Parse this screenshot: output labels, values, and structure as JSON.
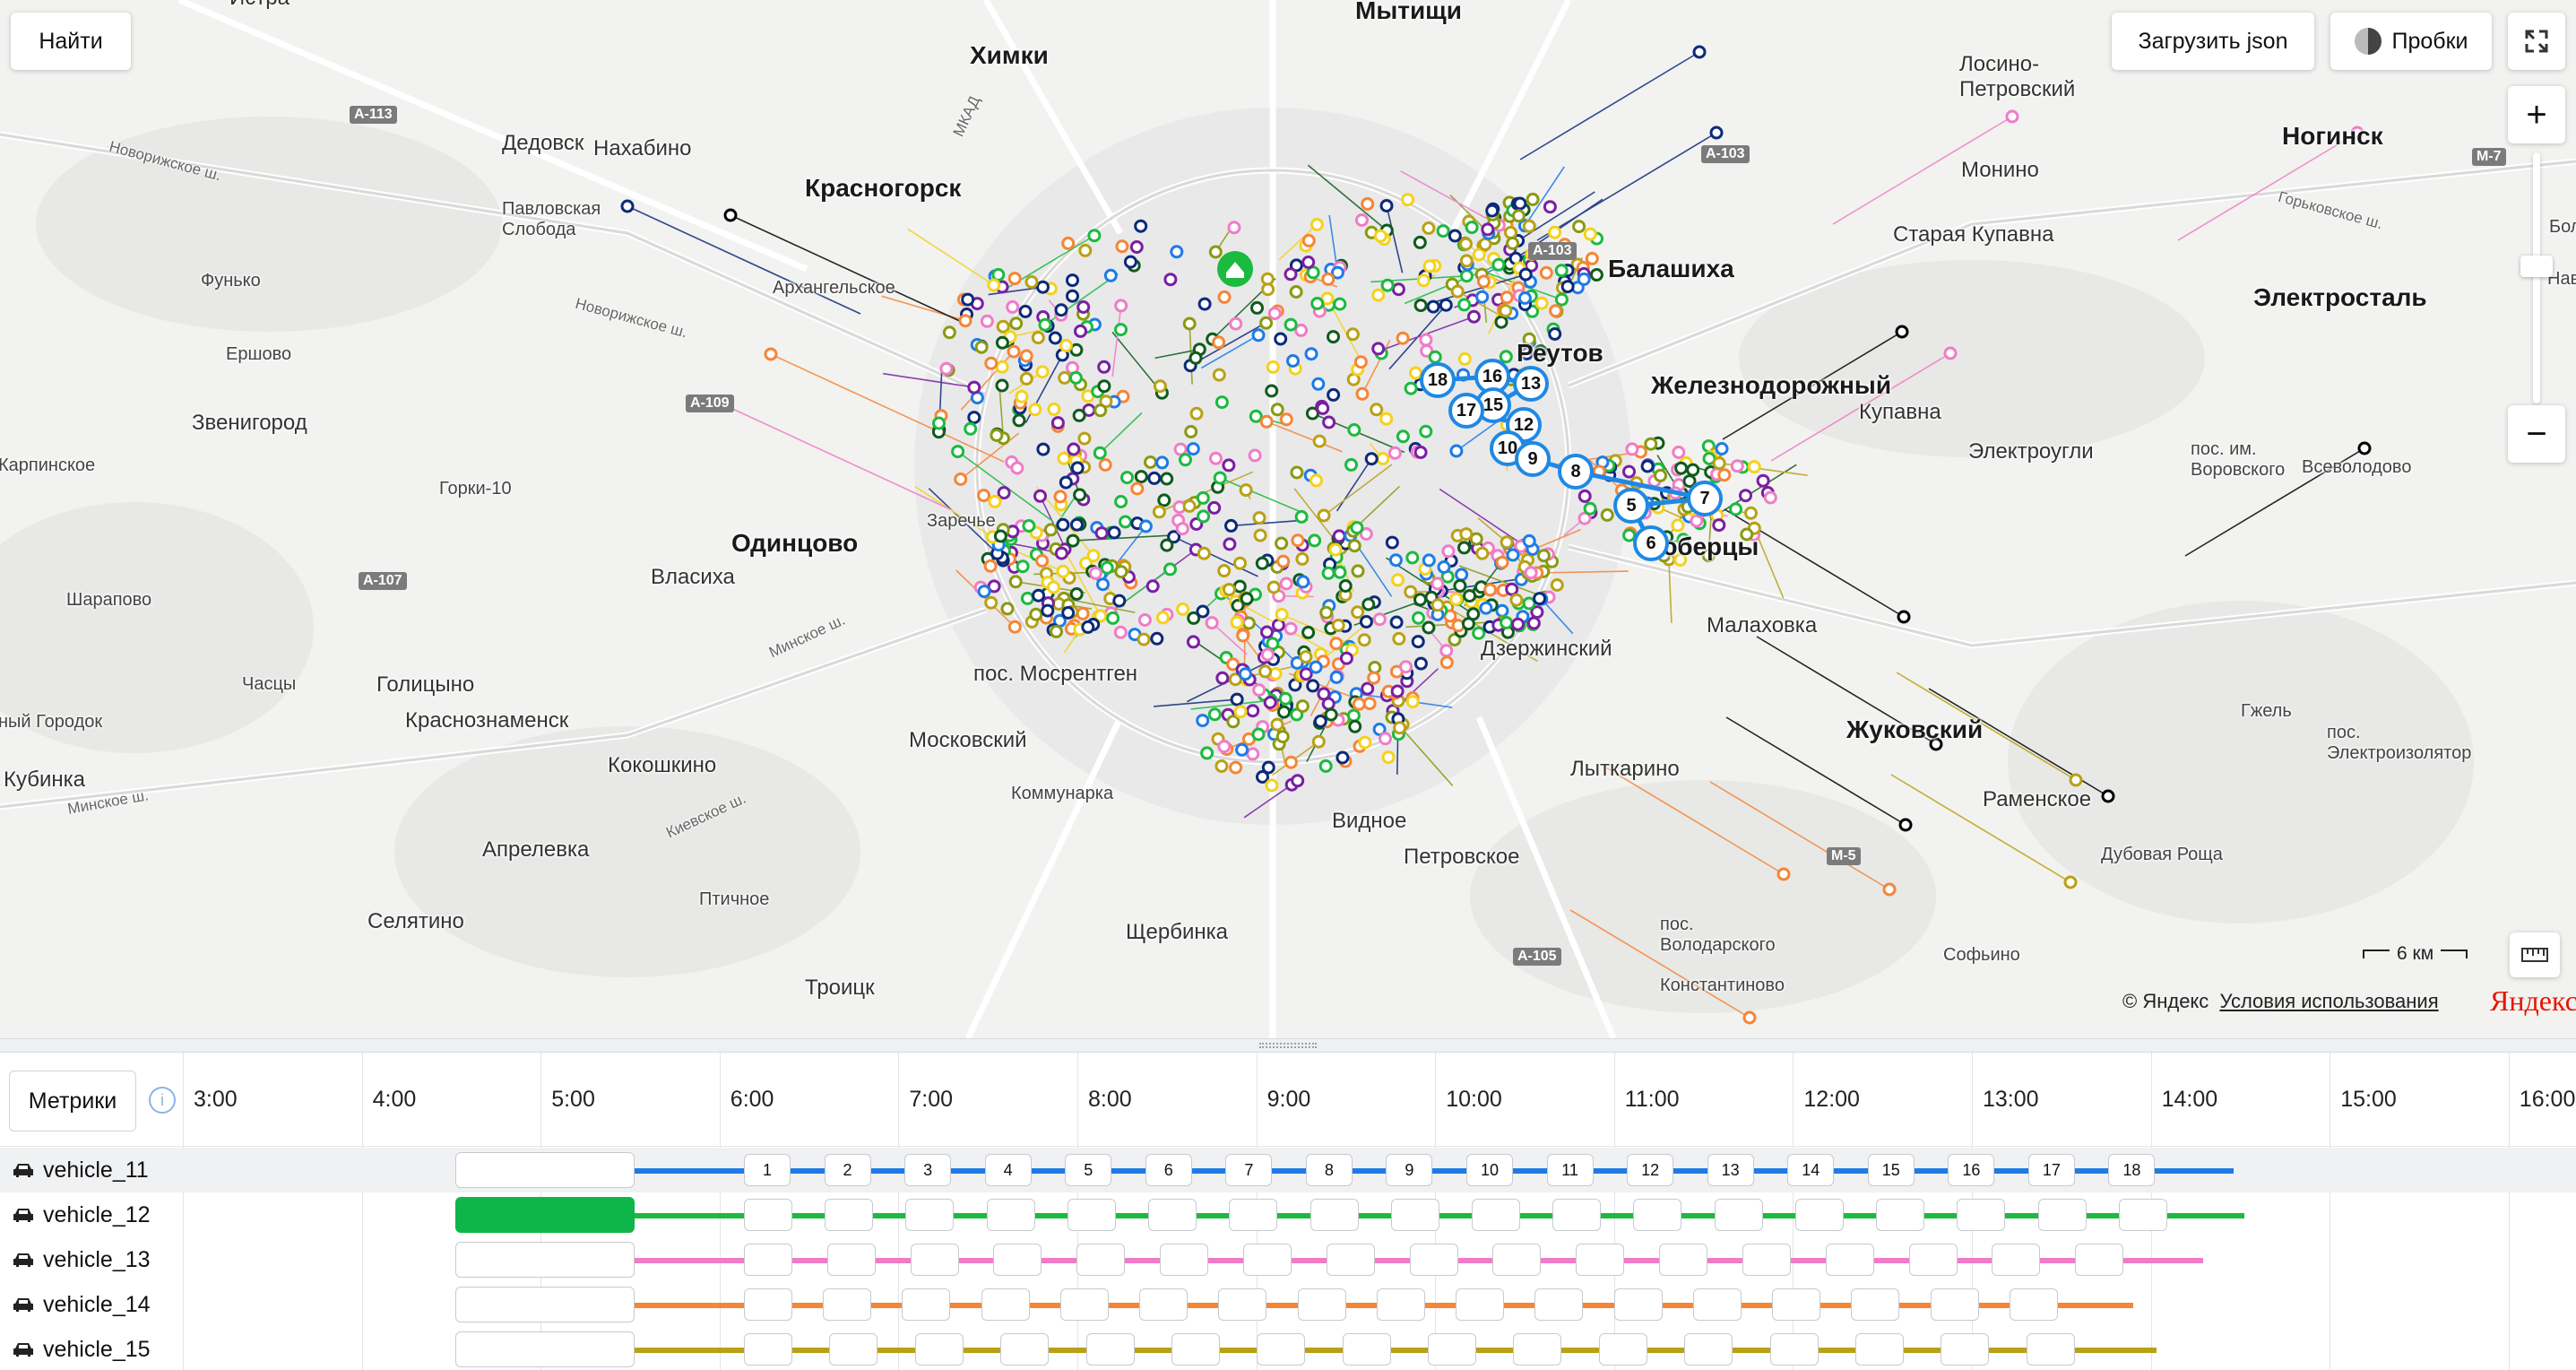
{
  "map": {
    "search_button": "Найти",
    "load_json_button": "Загрузить json",
    "traffic_button": "Пробки",
    "zoom_in": "+",
    "zoom_out": "−",
    "scale_label": "6 км",
    "attribution": "© Яндекс",
    "terms_link": "Условия использования",
    "logo": "Яндекс",
    "places": [
      {
        "name": "Химки",
        "cls": "bold"
      },
      {
        "name": "Мытищи",
        "cls": "bold"
      },
      {
        "name": "Лосино-\nПетровский",
        "cls": "med"
      },
      {
        "name": "Дедовск",
        "cls": "med"
      },
      {
        "name": "Нахабино",
        "cls": "med"
      },
      {
        "name": "Красногорск",
        "cls": "bold"
      },
      {
        "name": "Павловская\nСлобода",
        "cls": "small"
      },
      {
        "name": "Архангельское",
        "cls": "small"
      },
      {
        "name": "Фунько",
        "cls": "small"
      },
      {
        "name": "Ершово",
        "cls": "small"
      },
      {
        "name": "Звенигород",
        "cls": "med"
      },
      {
        "name": "Горки-10",
        "cls": "small"
      },
      {
        "name": "Одинцово",
        "cls": "bold"
      },
      {
        "name": "Власиха",
        "cls": "med"
      },
      {
        "name": "Заречье",
        "cls": "small"
      },
      {
        "name": "Шарапово",
        "cls": "small"
      },
      {
        "name": "Часцы",
        "cls": "small"
      },
      {
        "name": "Голицыно",
        "cls": "med"
      },
      {
        "name": "Краснознаменск",
        "cls": "med"
      },
      {
        "name": "Кубинка",
        "cls": "med"
      },
      {
        "name": "Кокошкино",
        "cls": "med"
      },
      {
        "name": "Московский",
        "cls": "med"
      },
      {
        "name": "пос. Мосрентген",
        "cls": "med"
      },
      {
        "name": "Коммунарка",
        "cls": "small"
      },
      {
        "name": "Апрелевка",
        "cls": "med"
      },
      {
        "name": "Птичное",
        "cls": "small"
      },
      {
        "name": "Селятино",
        "cls": "med"
      },
      {
        "name": "Троицк",
        "cls": "med"
      },
      {
        "name": "Щербинка",
        "cls": "med"
      },
      {
        "name": "Видное",
        "cls": "med"
      },
      {
        "name": "Петровское",
        "cls": "med"
      },
      {
        "name": "Дзержинский",
        "cls": "med"
      },
      {
        "name": "Лыткарино",
        "cls": "med"
      },
      {
        "name": "пос.\nВолодарского",
        "cls": "small"
      },
      {
        "name": "Константиново",
        "cls": "small"
      },
      {
        "name": "Малаховка",
        "cls": "med"
      },
      {
        "name": "Жуковский",
        "cls": "bold"
      },
      {
        "name": "Раменское",
        "cls": "med"
      },
      {
        "name": "Дубовая Роща",
        "cls": "small"
      },
      {
        "name": "Софьино",
        "cls": "small"
      },
      {
        "name": "Гжель",
        "cls": "small"
      },
      {
        "name": "пос.\nЭлектроизолятор",
        "cls": "small"
      },
      {
        "name": "Балашиха",
        "cls": "bold"
      },
      {
        "name": "Железнодорожный",
        "cls": "bold"
      },
      {
        "name": "Купавна",
        "cls": "med"
      },
      {
        "name": "Электроугли",
        "cls": "med"
      },
      {
        "name": "пос. им.\nВоровского",
        "cls": "small"
      },
      {
        "name": "Всеволодово",
        "cls": "small"
      },
      {
        "name": "Электросталь",
        "cls": "bold"
      },
      {
        "name": "Старая Купавна",
        "cls": "med"
      },
      {
        "name": "Монино",
        "cls": "med"
      },
      {
        "name": "Ногинск",
        "cls": "bold"
      },
      {
        "name": "Люберцы",
        "cls": "bold"
      },
      {
        "name": "Реутов",
        "cls": "bold"
      },
      {
        "name": "Истра",
        "cls": "med"
      },
      {
        "name": "Карпинское",
        "cls": "small"
      },
      {
        "name": "ный Городок",
        "cls": "small"
      },
      {
        "name": "Боль",
        "cls": "small"
      },
      {
        "name": "Нав",
        "cls": "small"
      }
    ],
    "highways": [
      "А-113",
      "А-109",
      "А-107",
      "А-103",
      "А-103",
      "М-7",
      "М-5",
      "А-105"
    ],
    "roads": [
      "МКАД",
      "Новорижское ш.",
      "Новорижское ш.",
      "Минское ш.",
      "Минское ш.",
      "Киевское ш.",
      "Горьковское ш."
    ],
    "route_markers": [
      "18",
      "16",
      "13",
      "15",
      "17",
      "12",
      "10",
      "9",
      "8",
      "7",
      "5",
      "6"
    ]
  },
  "timeline": {
    "metrics_button": "Метрики",
    "info_icon": "i",
    "hours": [
      "3:00",
      "4:00",
      "5:00",
      "6:00",
      "7:00",
      "8:00",
      "9:00",
      "10:00",
      "11:00",
      "12:00",
      "13:00",
      "14:00",
      "15:00",
      "16:00"
    ],
    "vehicles": [
      {
        "name": "vehicle_11",
        "color": "#1e7be6",
        "stops": [
          "1",
          "2",
          "3",
          "4",
          "5",
          "6",
          "7",
          "8",
          "9",
          "10",
          "11",
          "12",
          "13",
          "14",
          "15",
          "16",
          "17",
          "18"
        ]
      },
      {
        "name": "vehicle_12",
        "color": "#1cba3f",
        "stops": [
          "",
          "",
          "",
          "",
          "",
          "",
          "",
          "",
          "",
          "",
          "",
          "",
          "",
          "",
          "",
          "",
          "",
          ""
        ]
      },
      {
        "name": "vehicle_13",
        "color": "#f07cc7",
        "stops": [
          "",
          "",
          "",
          "",
          "",
          "",
          "",
          "",
          "",
          "",
          "",
          "",
          "",
          "",
          "",
          "",
          ""
        ]
      },
      {
        "name": "vehicle_14",
        "color": "#f68536",
        "stops": [
          "",
          "",
          "",
          "",
          "",
          "",
          "",
          "",
          "",
          "",
          "",
          "",
          "",
          "",
          "",
          "",
          ""
        ]
      },
      {
        "name": "vehicle_15",
        "color": "#b9a115",
        "stops": [
          "",
          "",
          "",
          "",
          "",
          "",
          "",
          "",
          "",
          "",
          "",
          "",
          "",
          "",
          "",
          ""
        ]
      }
    ]
  },
  "colors": {
    "route_palette": [
      "#1e7be6",
      "#1cba3f",
      "#f07cc7",
      "#f68536",
      "#b9a115",
      "#7a1fa2",
      "#0d2a7a",
      "#0f5c1c",
      "#f4d21c",
      "#8a9a10",
      "#000000"
    ]
  }
}
